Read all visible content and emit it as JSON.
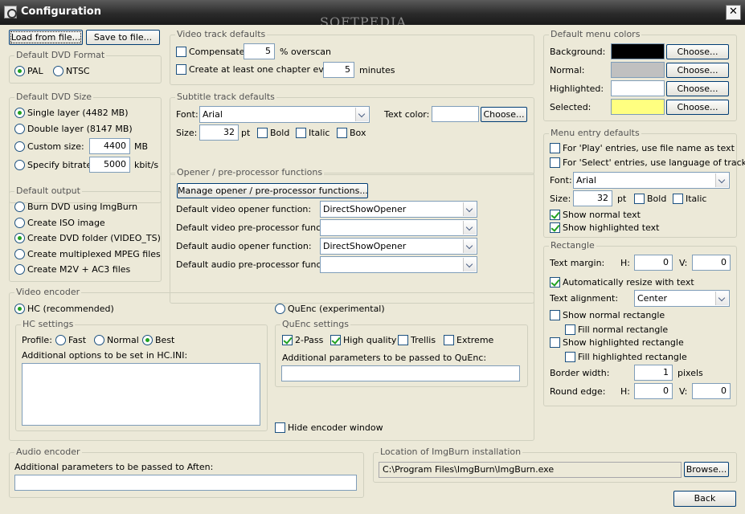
{
  "window": {
    "title": "Configuration",
    "watermark": "SOFTPEDIA",
    "close_label": "✕"
  },
  "file_buttons": {
    "load": "Load from file...",
    "save": "Save to file..."
  },
  "dvd_format": {
    "legend": "Default DVD Format",
    "options": [
      "PAL",
      "NTSC"
    ],
    "selected": "PAL"
  },
  "dvd_size": {
    "legend": "Default DVD Size",
    "single": "Single layer (4482 MB)",
    "double": "Double layer (8147 MB)",
    "custom": "Custom size:",
    "custom_value": "4400",
    "custom_unit": "MB",
    "bitrate": "Specify bitrate:",
    "bitrate_value": "5000",
    "bitrate_unit": "kbit/s"
  },
  "default_output": {
    "legend": "Default output",
    "options": [
      "Burn DVD using ImgBurn",
      "Create ISO image",
      "Create DVD folder (VIDEO_TS)",
      "Create multiplexed MPEG files",
      "Create M2V + AC3 files"
    ]
  },
  "video_track": {
    "legend": "Video track defaults",
    "compensate": "Compensate",
    "overscan_value": "5",
    "overscan_unit": "% overscan",
    "chapter": "Create at least one chapter every",
    "chapter_value": "5",
    "chapter_unit": "minutes"
  },
  "subtitle_track": {
    "legend": "Subtitle track defaults",
    "font_label": "Font:",
    "font_value": "Arial",
    "text_color_label": "Text color:",
    "choose": "Choose...",
    "size_label": "Size:",
    "size_value": "32",
    "size_unit": "pt",
    "bold": "Bold",
    "italic": "Italic",
    "box": "Box"
  },
  "opener": {
    "legend": "Opener / pre-processor functions",
    "manage_button": "Manage opener / pre-processor functions...",
    "video_opener_label": "Default video opener function:",
    "video_opener_value": "DirectShowOpener",
    "video_pre_label": "Default video pre-processor function:",
    "video_pre_value": "",
    "audio_opener_label": "Default audio opener function:",
    "audio_opener_value": "DirectShowOpener",
    "audio_pre_label": "Default audio pre-processor function:",
    "audio_pre_value": ""
  },
  "video_encoder": {
    "legend": "Video encoder",
    "hc": "HC (recommended)",
    "quenc": "QuEnc (experimental)",
    "hc_settings": {
      "legend": "HC settings",
      "profile_label": "Profile:",
      "profiles": [
        "Fast",
        "Normal",
        "Best"
      ],
      "selected": "Best",
      "options_label": "Additional options to be set in HC.INI:"
    },
    "quenc_settings": {
      "legend": "QuEnc settings",
      "two_pass": "2-Pass",
      "high_quality": "High quality",
      "trellis": "Trellis",
      "extreme": "Extreme",
      "params_label": "Additional parameters to be passed to QuEnc:",
      "params_value": ""
    },
    "hide_window": "Hide encoder window"
  },
  "audio_encoder": {
    "legend": "Audio encoder",
    "params_label": "Additional parameters to be passed to Aften:",
    "params_value": ""
  },
  "imgburn": {
    "legend": "Location of ImgBurn installation",
    "path": "C:\\Program Files\\ImgBurn\\ImgBurn.exe",
    "browse": "Browse..."
  },
  "menu_colors": {
    "legend": "Default menu colors",
    "choose": "Choose...",
    "rows": [
      {
        "label": "Background:",
        "color": "#000000"
      },
      {
        "label": "Normal:",
        "color": "#c0c0c0"
      },
      {
        "label": "Highlighted:",
        "color": "#ffffff"
      },
      {
        "label": "Selected:",
        "color": "#ffff80"
      }
    ]
  },
  "menu_entry": {
    "legend": "Menu entry defaults",
    "play_entries": "For 'Play' entries, use file name as text",
    "select_entries": "For 'Select' entries, use language of track",
    "font_label": "Font:",
    "font_value": "Arial",
    "size_label": "Size:",
    "size_value": "32",
    "size_unit": "pt",
    "bold": "Bold",
    "italic": "Italic",
    "show_normal": "Show normal text",
    "show_highlighted": "Show highlighted text"
  },
  "rectangle": {
    "legend": "Rectangle",
    "margin_label": "Text margin:",
    "h_label": "H:",
    "v_label": "V:",
    "margin_h": "0",
    "margin_v": "0",
    "auto_resize": "Automatically resize with text",
    "alignment_label": "Text alignment:",
    "alignment_value": "Center",
    "show_normal_rect": "Show normal rectangle",
    "fill_normal_rect": "Fill normal rectangle",
    "show_high_rect": "Show highlighted rectangle",
    "fill_high_rect": "Fill highlighted rectangle",
    "border_label": "Border width:",
    "border_value": "1",
    "border_unit": "pixels",
    "round_label": "Round edge:",
    "round_h": "0",
    "round_v": "0"
  },
  "back_button": "Back"
}
